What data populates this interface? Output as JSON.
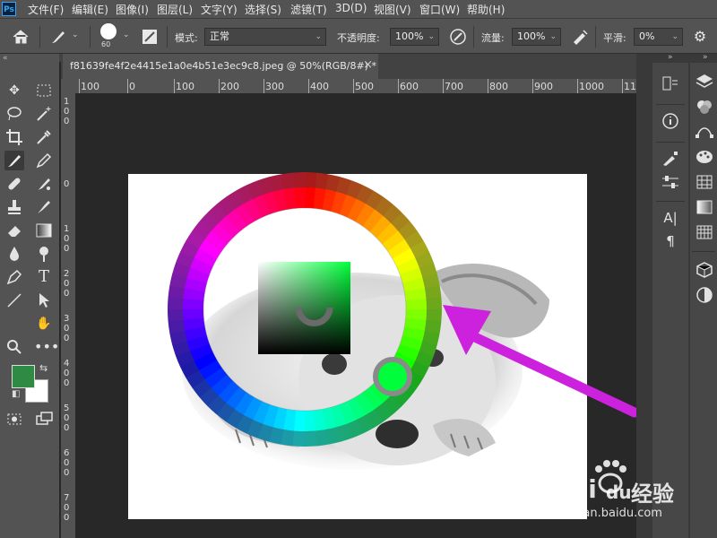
{
  "app": {
    "logo": "Ps"
  },
  "menu": [
    "文件(F)",
    "编辑(E)",
    "图像(I)",
    "图层(L)",
    "文字(Y)",
    "选择(S)",
    "滤镜(T)",
    "3D(D)",
    "视图(V)",
    "窗口(W)",
    "帮助(H)"
  ],
  "options": {
    "brush_size": "60",
    "mode_label": "模式:",
    "mode_value": "正常",
    "opacity_label": "不透明度:",
    "opacity_value": "100%",
    "flow_label": "流量:",
    "flow_value": "100%",
    "smoothing_label": "平滑:",
    "smoothing_value": "0%"
  },
  "document": {
    "tab_title": "f81639fe4f2e4415e1a0e4b51e3ec9c8.jpeg @ 50%(RGB/8#) *",
    "close_glyph": "×"
  },
  "ruler": {
    "h_ticks": [
      "100",
      "0",
      "100",
      "200",
      "300",
      "400",
      "500",
      "600",
      "700",
      "800",
      "900",
      "1000",
      "11"
    ],
    "v_ticks": [
      "1\n0\n0",
      "0",
      "1\n0\n0",
      "2\n0\n0",
      "3\n0\n0",
      "4\n0\n0",
      "5\n0\n0",
      "6\n0\n0",
      "7\n0\n0"
    ]
  },
  "colors": {
    "foreground": "#2f8a44",
    "background": "#ffffff",
    "picked": "#00ff3a",
    "arrow": "#cc22dd",
    "accent": "#31a8ff"
  },
  "watermark": {
    "brand": "Bai",
    "brand2": "du",
    "cn": "经验",
    "url": "jingyan.baidu.com"
  },
  "icons": {
    "tools": [
      "move-icon",
      "marquee-icon",
      "lasso-icon",
      "magic-wand-icon",
      "crop-icon",
      "eyedropper-icon",
      "brush-icon",
      "pencil-icon",
      "healing-icon",
      "mixer-brush-icon",
      "stamp-icon",
      "smudge-icon",
      "eraser-icon",
      "gradient-icon",
      "blur-icon",
      "dodge-icon",
      "pen-icon",
      "type-icon",
      "path-select-icon",
      "direct-select-icon",
      "line-icon",
      "hand-icon",
      "zoom-icon",
      "more-icon"
    ]
  }
}
